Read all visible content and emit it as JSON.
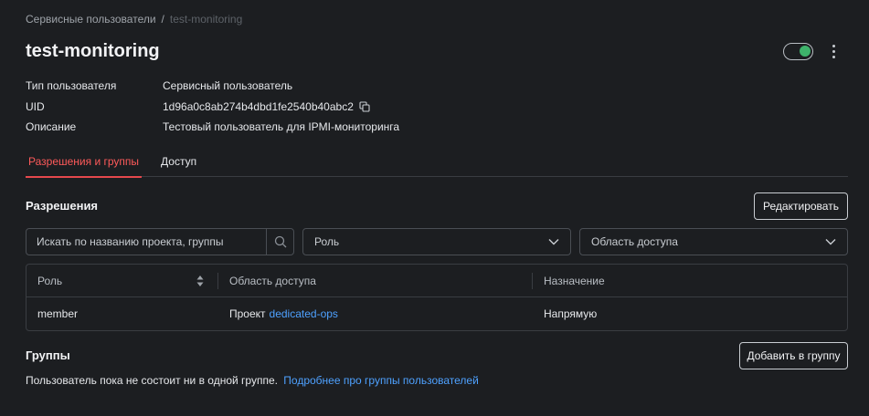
{
  "breadcrumb": {
    "parent": "Сервисные пользователи",
    "separator": "/",
    "current": "test-monitoring"
  },
  "page": {
    "title": "test-monitoring",
    "toggle_enabled": true
  },
  "info": {
    "type_label": "Тип пользователя",
    "type_value": "Сервисный пользователь",
    "uid_label": "UID",
    "uid_value": "1d96a0c8ab274b4dbd1fe2540b40abc2",
    "description_label": "Описание",
    "description_value": "Тестовый пользователь для IPMI-мониторинга"
  },
  "tabs": [
    {
      "label": "Разрешения и группы",
      "active": true
    },
    {
      "label": "Доступ",
      "active": false
    }
  ],
  "permissions": {
    "title": "Разрешения",
    "edit_label": "Редактировать",
    "search_placeholder": "Искать по названию проекта, группы",
    "role_select": "Роль",
    "scope_select": "Область доступа",
    "columns": [
      "Роль",
      "Область доступа",
      "Назначение"
    ],
    "rows": [
      {
        "role": "member",
        "scope_prefix": "Проект",
        "scope_link": "dedicated-ops",
        "assignment": "Напрямую"
      }
    ]
  },
  "groups": {
    "title": "Группы",
    "add_label": "Добавить в группу",
    "empty_text": "Пользователь пока не состоит ни в одной группе.",
    "more_link": "Подробнее про группы пользователей"
  },
  "colors": {
    "accent_tab": "#ff5a5a",
    "toggle_on": "#3eb36b",
    "link": "#4ea1ff"
  }
}
